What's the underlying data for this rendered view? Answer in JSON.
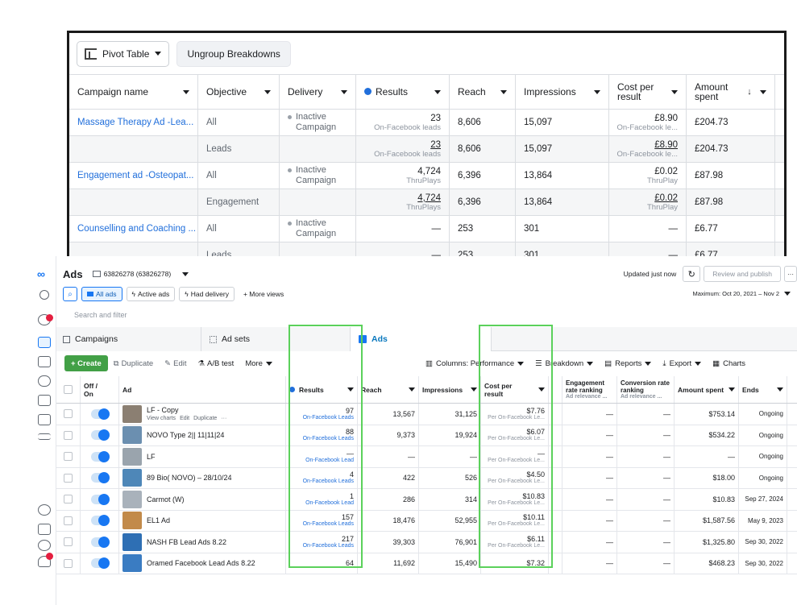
{
  "pivot": {
    "toolbar": {
      "pivot_label": "Pivot Table",
      "ungroup_label": "Ungroup Breakdowns"
    },
    "columns": [
      "Campaign name",
      "Objective",
      "Delivery",
      "Results",
      "Reach",
      "Impressions",
      "Cost per result",
      "Amount spent"
    ],
    "rows": [
      {
        "campaign": "Massage Therapy Ad -Lea...",
        "objective": "All",
        "delivery": "Inactive Campaign",
        "results": "23",
        "results_sub": "On-Facebook leads",
        "reach": "8,606",
        "impressions": "15,097",
        "cost": "£8.90",
        "cost_sub": "On-Facebook le...",
        "spent": "£204.73"
      },
      {
        "campaign": "",
        "objective": "Leads",
        "delivery": "",
        "results": "23",
        "results_sub": "On-Facebook leads",
        "reach": "8,606",
        "impressions": "15,097",
        "cost": "£8.90",
        "cost_sub": "On-Facebook le...",
        "spent": "£204.73"
      },
      {
        "campaign": "Engagement ad -Osteopat...",
        "objective": "All",
        "delivery": "Inactive Campaign",
        "results": "4,724",
        "results_sub": "ThruPlays",
        "reach": "6,396",
        "impressions": "13,864",
        "cost": "£0.02",
        "cost_sub": "ThruPlay",
        "spent": "£87.98"
      },
      {
        "campaign": "",
        "objective": "Engagement",
        "delivery": "",
        "results": "4,724",
        "results_sub": "ThruPlays",
        "reach": "6,396",
        "impressions": "13,864",
        "cost": "£0.02",
        "cost_sub": "ThruPlay",
        "spent": "£87.98"
      },
      {
        "campaign": "Counselling and Coaching ...",
        "objective": "All",
        "delivery": "Inactive Campaign",
        "results": "—",
        "results_sub": "",
        "reach": "253",
        "impressions": "301",
        "cost": "—",
        "cost_sub": "",
        "spent": "£6.77"
      },
      {
        "campaign": "",
        "objective": "Leads",
        "delivery": "",
        "results": "—",
        "results_sub": "",
        "reach": "253",
        "impressions": "301",
        "cost": "—",
        "cost_sub": "",
        "spent": "£6.77"
      }
    ]
  },
  "ads": {
    "title": "Ads",
    "account": "63826278 (63826278)",
    "updated": "Updated just now",
    "review_publish": "Review and publish",
    "date_range": "Maximum: Oct 20, 2021 – Nov 2",
    "views": {
      "all_ads": "All ads",
      "active_ads": "Active ads",
      "had_delivery": "Had delivery",
      "more_views": "+ More views"
    },
    "search_placeholder": "Search and filter",
    "tabs": {
      "campaigns": "Campaigns",
      "ad_sets": "Ad sets",
      "ads": "Ads"
    },
    "actions": {
      "create": "+ Create",
      "duplicate": "Duplicate",
      "edit": "Edit",
      "ab_test": "A/B test",
      "more": "More",
      "columns": "Columns: Performance",
      "breakdown": "Breakdown",
      "reports": "Reports",
      "export": "Export",
      "charts": "Charts"
    },
    "headers": {
      "offon": "Off / On",
      "ad": "Ad",
      "results": "Results",
      "reach": "Reach",
      "impressions": "Impressions",
      "cost": "Cost per result",
      "engagement": "Engagement rate ranking",
      "engagement_sub": "Ad relevance ...",
      "conversion": "Conversion rate ranking",
      "conversion_sub": "Ad relevance ...",
      "spent": "Amount spent",
      "ends": "Ends"
    },
    "first_row_actions": {
      "view_charts": "View charts",
      "edit": "Edit",
      "duplicate": "Duplicate"
    },
    "rows": [
      {
        "name": "LF - Copy",
        "results": "97",
        "results_sub": "On-Facebook Leads",
        "reach": "13,567",
        "impressions": "31,125",
        "cost": "$7.76",
        "cost_sub": "Per On-Facebook Le...",
        "eng": "—",
        "conv": "—",
        "spent": "$753.14",
        "ends": "Ongoing",
        "thumb": "#8b7f72"
      },
      {
        "name": "NOVO Type 2|| 11|11|24",
        "results": "88",
        "results_sub": "On-Facebook Leads",
        "reach": "9,373",
        "impressions": "19,924",
        "cost": "$6.07",
        "cost_sub": "Per On-Facebook Le...",
        "eng": "—",
        "conv": "—",
        "spent": "$534.22",
        "ends": "Ongoing",
        "thumb": "#6b8fb0"
      },
      {
        "name": "LF",
        "results": "—",
        "results_sub": "On-Facebook Lead",
        "reach": "—",
        "impressions": "—",
        "cost": "—",
        "cost_sub": "Per On-Facebook Le...",
        "eng": "—",
        "conv": "—",
        "spent": "—",
        "ends": "Ongoing",
        "thumb": "#9aa4ad"
      },
      {
        "name": "89 Bio( NOVO) – 28/10/24",
        "results": "4",
        "results_sub": "On-Facebook Leads",
        "reach": "422",
        "impressions": "526",
        "cost": "$4.50",
        "cost_sub": "Per On-Facebook Le...",
        "eng": "—",
        "conv": "—",
        "spent": "$18.00",
        "ends": "Ongoing",
        "thumb": "#4e87b8"
      },
      {
        "name": "Carmot (W)",
        "results": "1",
        "results_sub": "On-Facebook Lead",
        "reach": "286",
        "impressions": "314",
        "cost": "$10.83",
        "cost_sub": "Per On-Facebook Le...",
        "eng": "—",
        "conv": "—",
        "spent": "$10.83",
        "ends": "Sep 27, 2024",
        "thumb": "#a9b2bb"
      },
      {
        "name": "EL1 Ad",
        "results": "157",
        "results_sub": "On-Facebook Leads",
        "reach": "18,476",
        "impressions": "52,955",
        "cost": "$10.11",
        "cost_sub": "Per On-Facebook Le...",
        "eng": "—",
        "conv": "—",
        "spent": "$1,587.56",
        "ends": "May 9, 2023",
        "thumb": "#c28a4a"
      },
      {
        "name": "NASH FB Lead Ads 8.22",
        "results": "217",
        "results_sub": "On-Facebook Leads",
        "reach": "39,303",
        "impressions": "76,901",
        "cost": "$6.11",
        "cost_sub": "Per On-Facebook Le...",
        "eng": "—",
        "conv": "—",
        "spent": "$1,325.80",
        "ends": "Sep 30, 2022",
        "thumb": "#2e6fb4"
      },
      {
        "name": "Oramed Facebook Lead Ads 8.22",
        "results": "64",
        "results_sub": "",
        "reach": "11,692",
        "impressions": "15,490",
        "cost": "$7.32",
        "cost_sub": "",
        "eng": "—",
        "conv": "—",
        "spent": "$468.23",
        "ends": "Sep 30, 2022",
        "thumb": "#3a7cc2"
      }
    ]
  }
}
